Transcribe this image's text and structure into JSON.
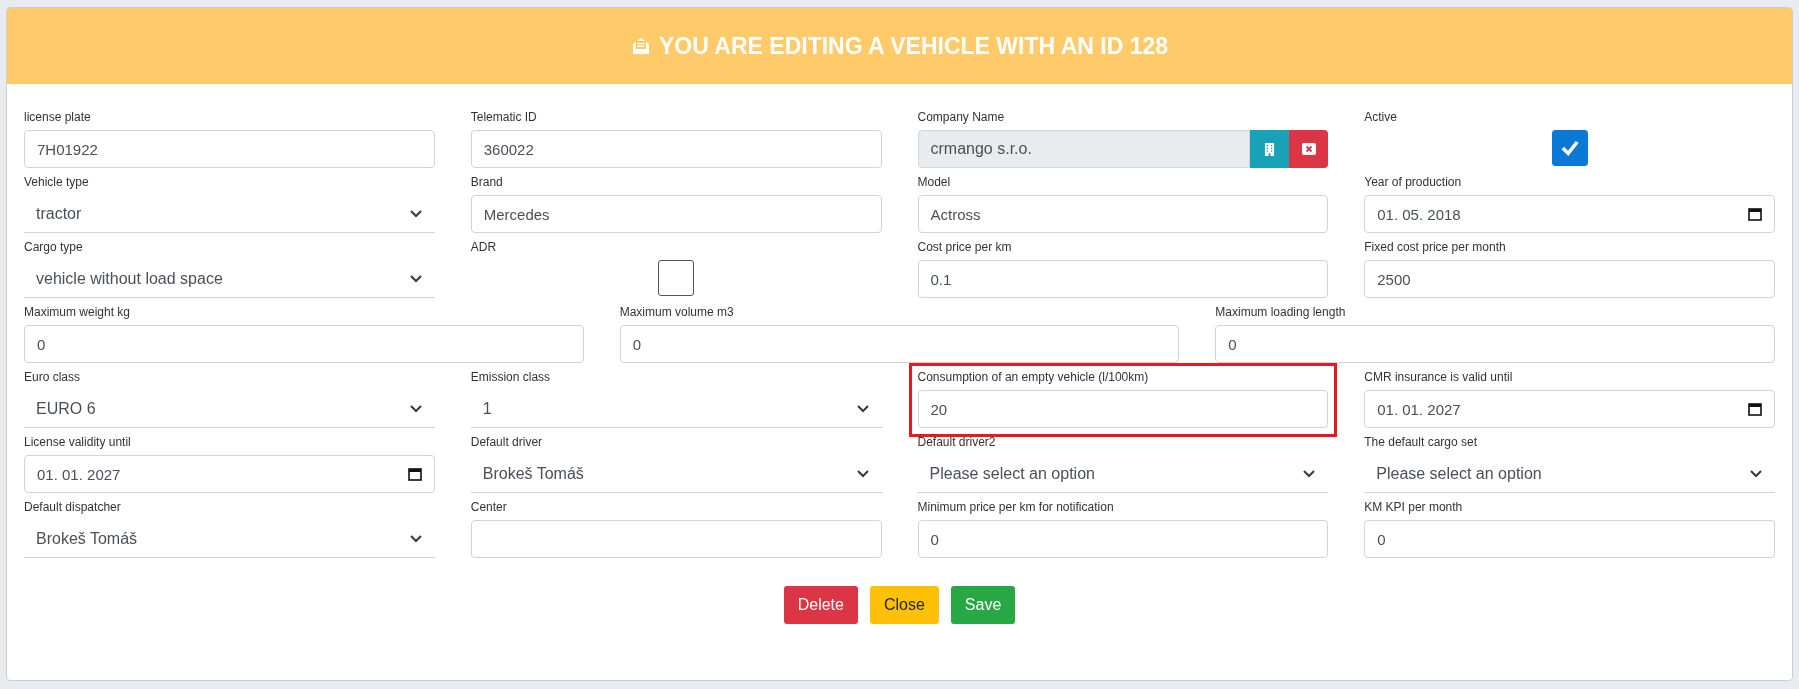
{
  "header": {
    "title": "YOU ARE EDITING A VEHICLE WITH AN ID 128"
  },
  "rows": [
    {
      "fields": [
        {
          "kind": "text",
          "label": "license plate",
          "value": "7H01922",
          "highlighted": false
        },
        {
          "kind": "text",
          "label": "Telematic ID",
          "value": "360022",
          "highlighted": false
        },
        {
          "kind": "company",
          "label": "Company Name",
          "value": "crmango s.r.o.",
          "highlighted": false
        },
        {
          "kind": "checkbox",
          "label": "Active",
          "checked": true,
          "highlighted": false
        }
      ]
    },
    {
      "fields": [
        {
          "kind": "select",
          "label": "Vehicle type",
          "value": "tractor",
          "highlighted": false
        },
        {
          "kind": "text",
          "label": "Brand",
          "value": "Mercedes",
          "highlighted": false
        },
        {
          "kind": "text",
          "label": "Model",
          "value": "Actross",
          "highlighted": false
        },
        {
          "kind": "date",
          "label": "Year of production",
          "value": "01. 05. 2018",
          "highlighted": false
        }
      ]
    },
    {
      "fields": [
        {
          "kind": "select",
          "label": "Cargo type",
          "value": "vehicle without load space",
          "highlighted": false
        },
        {
          "kind": "checkbox",
          "label": "ADR",
          "checked": false,
          "highlighted": false
        },
        {
          "kind": "text",
          "label": "Cost price per km",
          "value": "0.1",
          "highlighted": false
        },
        {
          "kind": "text",
          "label": "Fixed cost price per month",
          "value": "2500",
          "highlighted": false
        }
      ]
    },
    {
      "fields": [
        {
          "kind": "text",
          "label": "Maximum weight kg",
          "value": "0",
          "highlighted": false
        },
        {
          "kind": "text",
          "label": "Maximum volume m3",
          "value": "0",
          "highlighted": false
        },
        {
          "kind": "text",
          "label": "Maximum loading length",
          "value": "0",
          "highlighted": false
        }
      ]
    },
    {
      "fields": [
        {
          "kind": "select",
          "label": "Euro class",
          "value": "EURO 6",
          "highlighted": false
        },
        {
          "kind": "select",
          "label": "Emission class",
          "value": "1",
          "highlighted": false
        },
        {
          "kind": "text",
          "label": "Consumption of an empty vehicle (l/100km)",
          "value": "20",
          "highlighted": true
        },
        {
          "kind": "date",
          "label": "CMR insurance is valid until",
          "value": "01. 01. 2027",
          "highlighted": false
        }
      ]
    },
    {
      "fields": [
        {
          "kind": "date",
          "label": "License validity until",
          "value": "01. 01. 2027",
          "highlighted": false
        },
        {
          "kind": "select",
          "label": "Default driver",
          "value": "Brokeš Tomáš",
          "highlighted": false
        },
        {
          "kind": "select",
          "label": "Default driver2",
          "value": "Please select an option",
          "highlighted": false
        },
        {
          "kind": "select",
          "label": "The default cargo set",
          "value": "Please select an option",
          "highlighted": false
        }
      ]
    },
    {
      "fields": [
        {
          "kind": "select",
          "label": "Default dispatcher",
          "value": "Brokeš Tomáš",
          "highlighted": false
        },
        {
          "kind": "text",
          "label": "Center",
          "highlighted": false
        },
        {
          "kind": "text",
          "label": "Minimum price per km for notification",
          "value": "0",
          "highlighted": false
        },
        {
          "kind": "text",
          "label": "KM KPI per month",
          "value": "0",
          "highlighted": false
        }
      ]
    }
  ],
  "buttons": [
    {
      "kind": "delete",
      "label": "Delete"
    },
    {
      "kind": "close",
      "label": "Close"
    },
    {
      "kind": "save",
      "label": "Save"
    }
  ]
}
